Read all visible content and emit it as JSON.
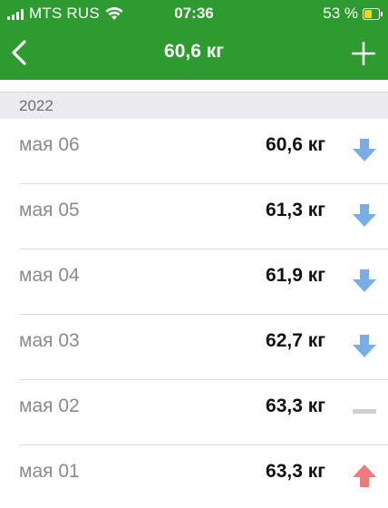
{
  "status_bar": {
    "carrier": "MTS RUS",
    "time": "07:36",
    "battery": "53 %",
    "battery_level": 0.53
  },
  "nav": {
    "title": "60,6 кг",
    "back_icon": "chevron-left-icon",
    "add_icon": "plus-icon"
  },
  "section": {
    "title": "2022"
  },
  "colors": {
    "header_green": "#2d9b30",
    "down_arrow": "#77aee8",
    "up_arrow": "#f07a78",
    "flat_dash": "#cfcfcf"
  },
  "entries": [
    {
      "date": "мая 06",
      "weight": "60,6 кг",
      "trend": "down"
    },
    {
      "date": "мая 05",
      "weight": "61,3 кг",
      "trend": "down"
    },
    {
      "date": "мая 04",
      "weight": "61,9 кг",
      "trend": "down"
    },
    {
      "date": "мая 03",
      "weight": "62,7 кг",
      "trend": "down"
    },
    {
      "date": "мая 02",
      "weight": "63,3 кг",
      "trend": "flat"
    },
    {
      "date": "мая 01",
      "weight": "63,3 кг",
      "trend": "up"
    }
  ]
}
